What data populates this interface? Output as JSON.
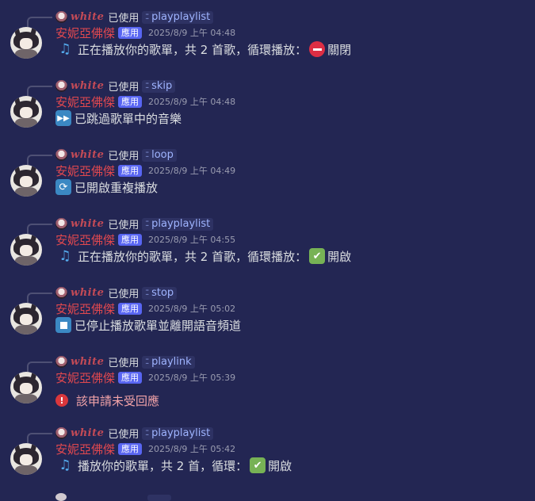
{
  "colors": {
    "background": "#232653",
    "author": "#e0484f",
    "app_badge": "#5865f2",
    "command": "#9fb4ff",
    "error_text": "#f2a3a8"
  },
  "messages": [
    {
      "reply_user": "white",
      "reply_used": "已使用",
      "command": "playplaylist",
      "author": "安妮亞佛傑",
      "badge": "應用",
      "timestamp": "2025/8/9 上午 04:48",
      "icon": "musical-notes-icon",
      "text": "正在播放你的歌單，共 2 首歌，循環播放：",
      "status_icon": "no-entry-icon",
      "status": "關閉"
    },
    {
      "reply_user": "white",
      "reply_used": "已使用",
      "command": "skip",
      "author": "安妮亞佛傑",
      "badge": "應用",
      "timestamp": "2025/8/9 上午 04:48",
      "icon": "next-track-icon",
      "text": "已跳過歌單中的音樂"
    },
    {
      "reply_user": "white",
      "reply_used": "已使用",
      "command": "loop",
      "author": "安妮亞佛傑",
      "badge": "應用",
      "timestamp": "2025/8/9 上午 04:49",
      "icon": "repeat-icon",
      "text": "已開啟重複播放"
    },
    {
      "reply_user": "white",
      "reply_used": "已使用",
      "command": "playplaylist",
      "author": "安妮亞佛傑",
      "badge": "應用",
      "timestamp": "2025/8/9 上午 04:55",
      "icon": "musical-notes-icon",
      "text": "正在播放你的歌單，共 2 首歌，循環播放：",
      "status_icon": "check-mark-icon",
      "status": "開啟"
    },
    {
      "reply_user": "white",
      "reply_used": "已使用",
      "command": "stop",
      "author": "安妮亞佛傑",
      "badge": "應用",
      "timestamp": "2025/8/9 上午 05:02",
      "icon": "stop-icon",
      "text": "已停止播放歌單並離開語音頻道"
    },
    {
      "reply_user": "white",
      "reply_used": "已使用",
      "command": "playlink",
      "author": "安妮亞佛傑",
      "badge": "應用",
      "timestamp": "2025/8/9 上午 05:39",
      "icon": "error-icon",
      "text": "該申請未受回應"
    },
    {
      "reply_user": "white",
      "reply_used": "已使用",
      "command": "playplaylist",
      "author": "安妮亞佛傑",
      "badge": "應用",
      "timestamp": "2025/8/9 上午 05:42",
      "icon": "musical-notes-icon",
      "text": "播放你的歌單，共 2 首，循環：",
      "status_icon": "check-mark-icon",
      "status": "開啟"
    }
  ]
}
